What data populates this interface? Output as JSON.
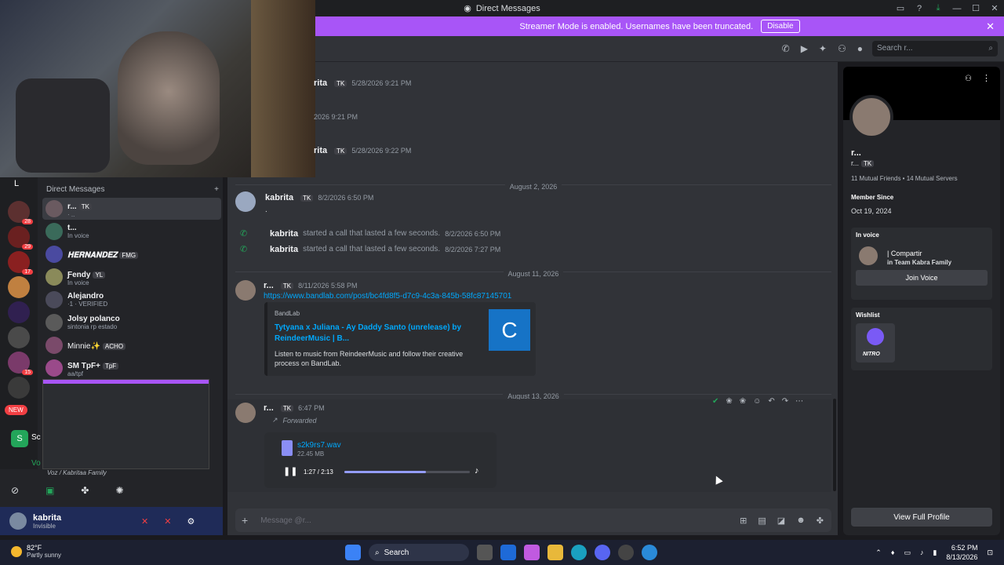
{
  "window": {
    "title": "Direct Messages"
  },
  "banner": {
    "text": "Streamer Mode is enabled. Usernames have been truncated.",
    "disable_label": "Disable"
  },
  "search": {
    "placeholder": "Search r..."
  },
  "dm_header": "Direct Messages",
  "dm_add": "+",
  "guild_badges": [
    "28",
    "29",
    "17",
    "15"
  ],
  "guild_letter": "L",
  "new_badge": "NEW",
  "dms": [
    {
      "name": "r...",
      "tag": "TK",
      "sub": "· ..",
      "active": true
    },
    {
      "name": "t...",
      "tag": "",
      "sub": "In voice",
      "active": false
    },
    {
      "name": "𝐇𝐄𝐑𝐍𝐀𝐍𝐃𝐄𝐙",
      "tag": "FMG",
      "sub": "",
      "active": false
    },
    {
      "name": "Ƒendy",
      "tag": "YL",
      "sub": "In voice",
      "active": false
    },
    {
      "name": "Alejandro",
      "tag": "",
      "sub": "·1 · VERIFIED",
      "active": false
    },
    {
      "name": "Jolsy polanco",
      "tag": "",
      "sub": "sintonia rp estado",
      "active": false
    },
    {
      "name": "Minnie✨",
      "tag": "ACHO",
      "sub": "",
      "active": false
    },
    {
      "name": "SM TpF+",
      "tag": "TpF",
      "sub": "aa/tpf",
      "active": false
    }
  ],
  "voice_panel": {
    "server": "Sc",
    "channel": "Vo",
    "status": "Voz / Kabritaa Family"
  },
  "user_panel": {
    "name": "kabrita",
    "status": "Invisible"
  },
  "messages": {
    "top1": {
      "name": "rita",
      "tag": "TK",
      "time": "5/28/2026 9:21 PM"
    },
    "top2": {
      "time": "2026 9:21 PM"
    },
    "top3": {
      "name": "rita",
      "tag": "TK",
      "time": "5/28/2026 9:22 PM"
    },
    "date1": "August 2, 2026",
    "kab": {
      "name": "kabrita",
      "tag": "TK",
      "time": "8/2/2026 6:50 PM",
      "body": "."
    },
    "call1": {
      "name": "kabrita",
      "text": "started a call that lasted a few seconds.",
      "time": "8/2/2026 6:50 PM"
    },
    "call2": {
      "name": "kabrita",
      "text": "started a call that lasted a few seconds.",
      "time": "8/2/2026 7:27 PM"
    },
    "date2": "August 11, 2026",
    "link_msg": {
      "name": "r...",
      "tag": "TK",
      "time": "8/11/2026 5:58 PM",
      "link": "https://www.bandlab.com/post/bc4fd8f5-d7c9-4c3a-845b-58fc87145701"
    },
    "embed": {
      "provider": "BandLab",
      "title": "Tytyana x Juliana - Ay Daddy Santo (unrelease) by ReindeerMusic | B...",
      "desc": "Listen to music from ReindeerMusic and follow their creative process on BandLab.",
      "thumb_letter": "C"
    },
    "date3": "August 13, 2026",
    "fwd_msg": {
      "name": "r...",
      "tag": "TK",
      "time": "6:47 PM",
      "forwarded": "Forwarded"
    },
    "audio": {
      "filename": "s2k9rs7.wav",
      "size": "22.45 MB",
      "time": "1:27 / 2:13",
      "progress": 0.65
    }
  },
  "composer": {
    "placeholder": "Message @r..."
  },
  "profile": {
    "name": "r...",
    "handle": "r...",
    "tag": "TK",
    "mutual_friends": "11 Mutual Friends",
    "mutual_servers": "14 Mutual Servers",
    "member_since_label": "Member Since",
    "member_since": "Oct 19, 2024",
    "in_voice_label": "In voice",
    "voice_channel": "| Compartir",
    "voice_server": "in Team Kabra Family",
    "join_label": "Join Voice",
    "wishlist_label": "Wishlist",
    "wishlist_item": "NITRO",
    "view_full": "View Full Profile"
  },
  "taskbar": {
    "temp": "82°F",
    "weather": "Partly sunny",
    "search": "Search",
    "time": "6:52 PM",
    "date": "8/13/2026"
  },
  "colors": {
    "accent": "#a855f7",
    "link": "#00a8fc",
    "green": "#23a55a"
  }
}
